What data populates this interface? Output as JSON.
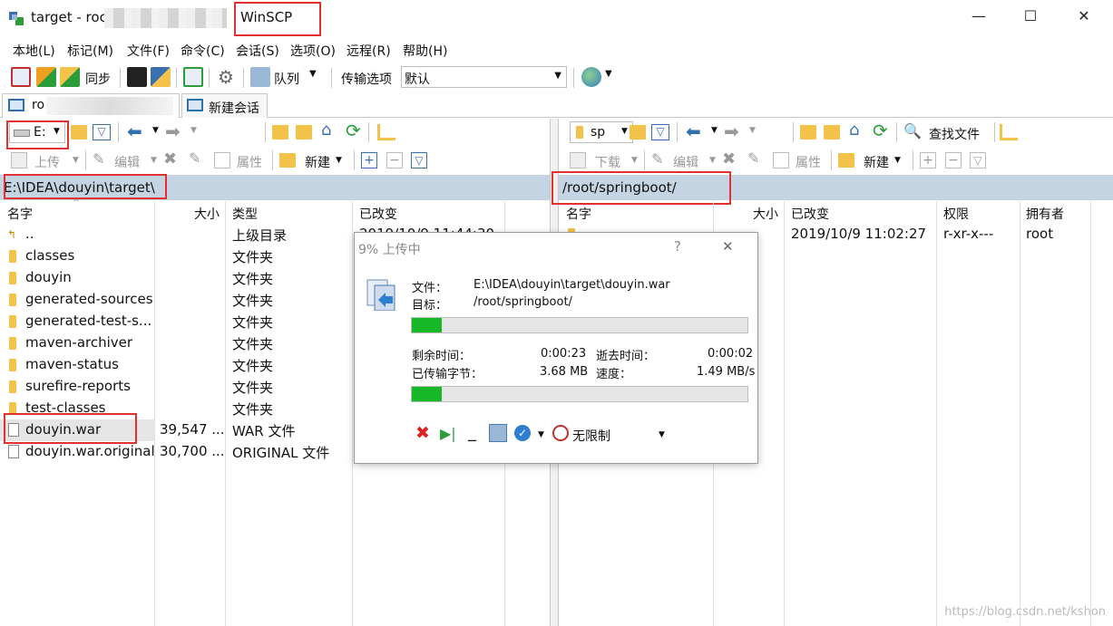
{
  "window": {
    "title": "target - roc",
    "app_name": "WinSCP",
    "minimize": "—",
    "maximize": "☐",
    "close": "✕"
  },
  "menu": [
    "本地(L)",
    "标记(M)",
    "文件(F)",
    "命令(C)",
    "会话(S)",
    "选项(O)",
    "远程(R)",
    "帮助(H)"
  ],
  "toolbar": {
    "sync_label": "同步",
    "queue_label": "队列",
    "transfer_options_label": "传输选项",
    "transfer_preset": "默认"
  },
  "tabs": {
    "session_label": "ro",
    "new_session_label": "新建会话"
  },
  "left_pane": {
    "drive": "E:",
    "upload_label": "上传",
    "edit_label": "编辑",
    "properties_label": "属性",
    "new_label": "新建",
    "path": "E:\\IDEA\\douyin\\target\\",
    "columns": [
      "名字",
      "大小",
      "类型",
      "已改变"
    ],
    "rows": [
      {
        "name": "..",
        "size": "",
        "type": "上级目录",
        "changed": "2019/10/9 11:44:30",
        "kind": "up"
      },
      {
        "name": "classes",
        "size": "",
        "type": "文件夹",
        "changed": "",
        "kind": "folder"
      },
      {
        "name": "douyin",
        "size": "",
        "type": "文件夹",
        "changed": "",
        "kind": "folder"
      },
      {
        "name": "generated-sources",
        "size": "",
        "type": "文件夹",
        "changed": "",
        "kind": "folder"
      },
      {
        "name": "generated-test-s...",
        "size": "",
        "type": "文件夹",
        "changed": "",
        "kind": "folder"
      },
      {
        "name": "maven-archiver",
        "size": "",
        "type": "文件夹",
        "changed": "",
        "kind": "folder"
      },
      {
        "name": "maven-status",
        "size": "",
        "type": "文件夹",
        "changed": "",
        "kind": "folder"
      },
      {
        "name": "surefire-reports",
        "size": "",
        "type": "文件夹",
        "changed": "",
        "kind": "folder"
      },
      {
        "name": "test-classes",
        "size": "",
        "type": "文件夹",
        "changed": "",
        "kind": "folder"
      },
      {
        "name": "douyin.war",
        "size": "39,547 ...",
        "type": "WAR 文件",
        "changed": "",
        "kind": "file"
      },
      {
        "name": "douyin.war.original",
        "size": "30,700 ...",
        "type": "ORIGINAL 文件",
        "changed": "",
        "kind": "file"
      }
    ]
  },
  "right_pane": {
    "drive": "sp",
    "download_label": "下载",
    "edit_label": "编辑",
    "properties_label": "属性",
    "new_label": "新建",
    "find_files_label": "查找文件",
    "path": "/root/springboot/",
    "columns": [
      "名字",
      "大小",
      "已改变",
      "权限",
      "拥有者"
    ],
    "rows": [
      {
        "name": "",
        "size": "",
        "changed": "2019/10/9 11:02:27",
        "rights": "r-xr-x---",
        "owner": "root"
      }
    ]
  },
  "dialog": {
    "title": "9% 上传中",
    "help": "?",
    "close": "✕",
    "file_label": "文件：",
    "file_value": "E:\\IDEA\\douyin\\target\\douyin.war",
    "target_label": "目标：",
    "target_value": "/root/springboot/",
    "file_progress": 0.09,
    "remaining_label": "剩余时间：",
    "remaining_value": "0:00:23",
    "elapsed_label": "逝去时间：",
    "elapsed_value": "0:00:02",
    "transferred_label": "已传输字节：",
    "transferred_value": "3.68 MB",
    "speed_label": "速度：",
    "speed_value": "1.49 MB/s",
    "total_progress": 0.09,
    "speed_limit_label": "无限制"
  },
  "watermark": "https://blog.csdn.net/kshon",
  "colors": {
    "path_bar": "#c4d4e3",
    "highlight_box": "#e03030",
    "progress_fill": "#16b827",
    "selected_row": "#cce4f7"
  }
}
